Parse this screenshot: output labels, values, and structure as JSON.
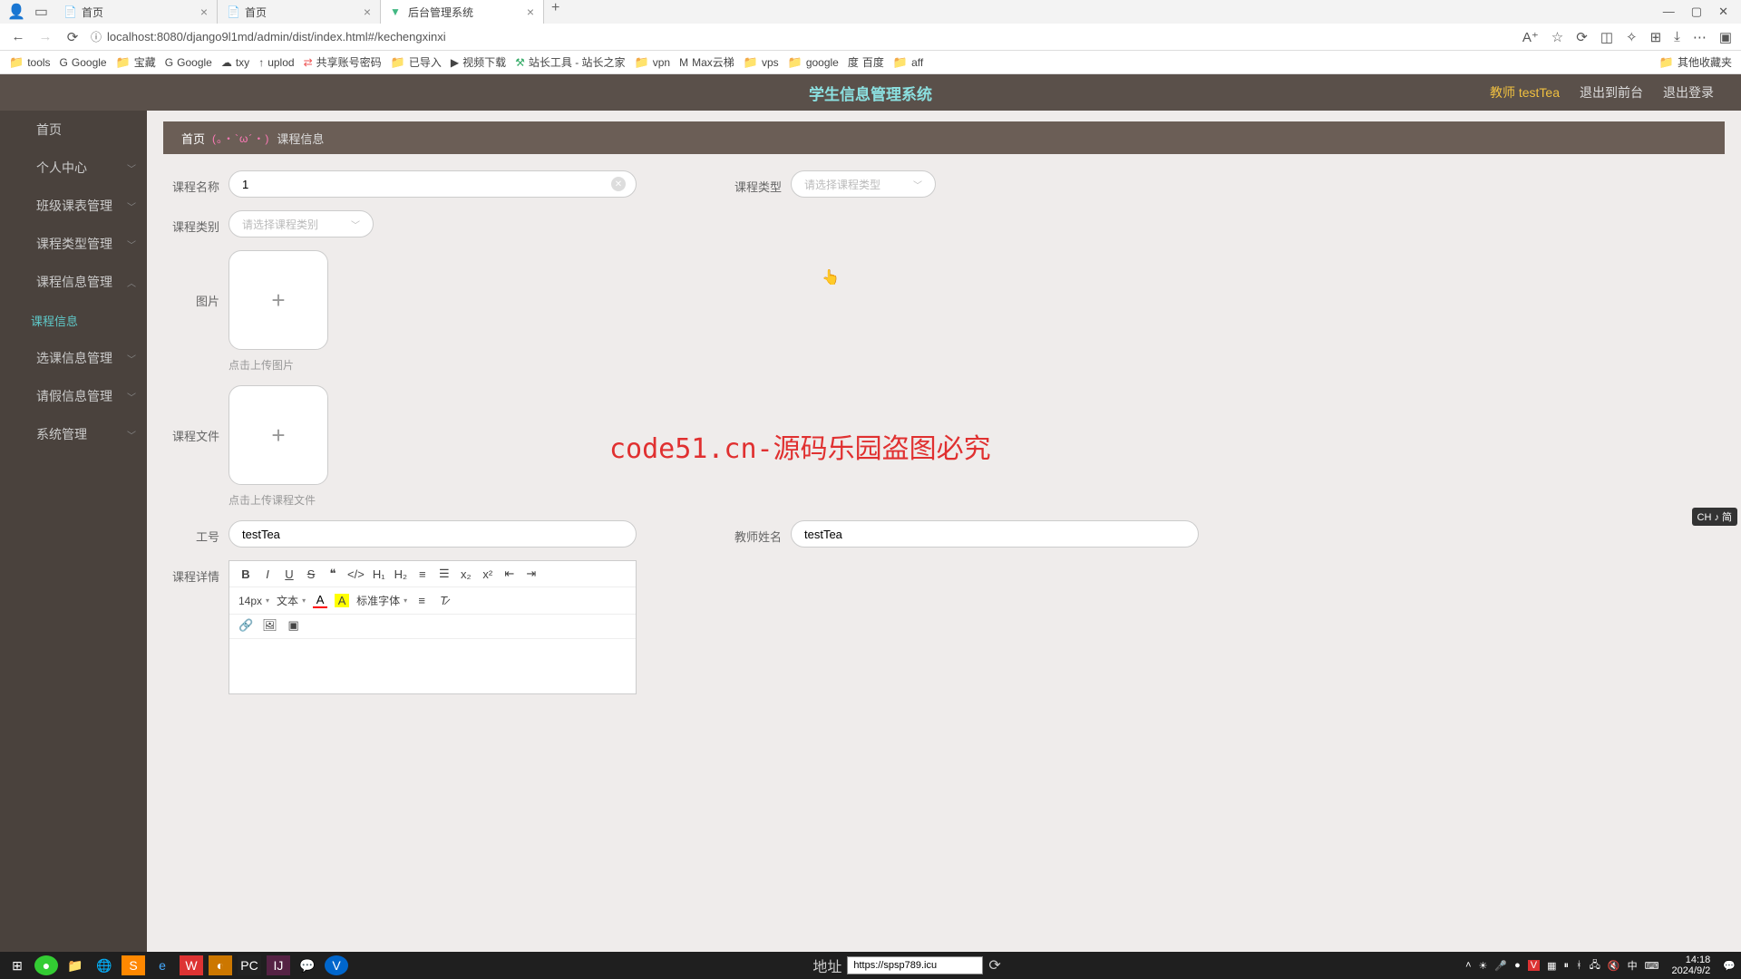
{
  "browser": {
    "tabs": [
      {
        "title": "首页"
      },
      {
        "title": "首页"
      },
      {
        "title": "后台管理系统"
      }
    ],
    "url": "localhost:8080/django9l1md/admin/dist/index.html#/kechengxinxi",
    "bookmarks": [
      "tools",
      "Google",
      "宝藏",
      "Google",
      "txy",
      "uplod",
      "共享账号密码",
      "已导入",
      "视频下载",
      "站长工具 - 站长之家",
      "vpn",
      "Max云梯",
      "vps",
      "google",
      "百度",
      "aff"
    ],
    "bookmark_right": "其他收藏夹"
  },
  "header": {
    "title": "学生信息管理系统",
    "user_label": "教师 testTea",
    "link_front": "退出到前台",
    "link_logout": "退出登录"
  },
  "sidebar": {
    "items": [
      {
        "label": "首页",
        "exp": false
      },
      {
        "label": "个人中心",
        "exp": true
      },
      {
        "label": "班级课表管理",
        "exp": true
      },
      {
        "label": "课程类型管理",
        "exp": true
      },
      {
        "label": "课程信息管理",
        "exp": true
      },
      {
        "label": "课程信息",
        "sub": true,
        "active": true
      },
      {
        "label": "选课信息管理",
        "exp": true
      },
      {
        "label": "请假信息管理",
        "exp": true
      },
      {
        "label": "系统管理",
        "exp": true
      }
    ]
  },
  "breadcrumb": {
    "home": "首页",
    "owl": "(。・`ω´・)",
    "current": "课程信息"
  },
  "form": {
    "course_name_label": "课程名称",
    "course_name_value": "1",
    "course_type_label": "课程类型",
    "course_type_placeholder": "请选择课程类型",
    "course_category_label": "课程类别",
    "course_category_placeholder": "请选择课程类别",
    "image_label": "图片",
    "image_hint": "点击上传图片",
    "file_label": "课程文件",
    "file_hint": "点击上传课程文件",
    "job_no_label": "工号",
    "job_no_value": "testTea",
    "teacher_name_label": "教师姓名",
    "teacher_name_value": "testTea",
    "detail_label": "课程详情",
    "editor": {
      "fontsize": "14px",
      "texttype": "文本",
      "fontfamily": "标准字体"
    }
  },
  "watermark": "code51.cn-源码乐园盗图必究",
  "taskbar": {
    "addr_label": "地址",
    "addr_value": "https://spsp789.icu",
    "time": "14:18",
    "date": "2024/9/2"
  },
  "ime": "CH ♪ 简"
}
